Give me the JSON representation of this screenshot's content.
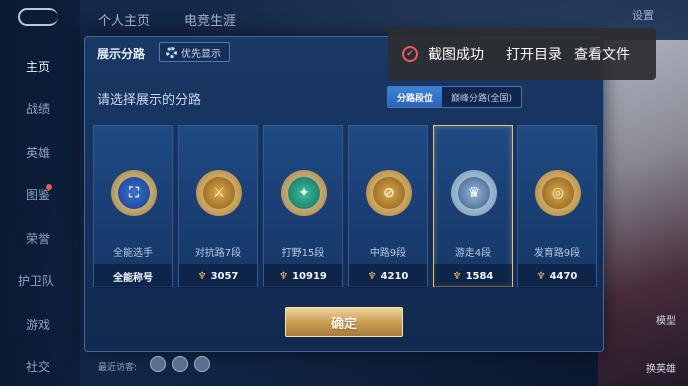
{
  "nav": {
    "items": [
      "主页",
      "战绩",
      "英雄",
      "图鉴",
      "荣誉",
      "护卫队",
      "游戏",
      "社交"
    ]
  },
  "top_tabs": [
    "个人主页",
    "电竞生涯"
  ],
  "top_right": "设置",
  "dialog": {
    "title": "展示分路",
    "priority_label": "优先显示",
    "subtitle": "请选择展示的分路",
    "segments": [
      "分路段位",
      "巅峰分路(全国)"
    ],
    "cards": [
      {
        "name": "全能选手",
        "score": "全能称号",
        "icon": "all-round-emblem-icon",
        "show_score_icon": false
      },
      {
        "name": "对抗路7段",
        "score": "3057",
        "icon": "clash-lane-emblem-icon",
        "show_score_icon": true
      },
      {
        "name": "打野15段",
        "score": "10919",
        "icon": "jungle-emblem-icon",
        "show_score_icon": true
      },
      {
        "name": "中路9段",
        "score": "4210",
        "icon": "mid-lane-emblem-icon",
        "show_score_icon": true
      },
      {
        "name": "游走4段",
        "score": "1584",
        "icon": "roam-emblem-icon",
        "show_score_icon": true
      },
      {
        "name": "发育路9段",
        "score": "4470",
        "icon": "farm-lane-emblem-icon",
        "show_score_icon": true
      }
    ],
    "selected_index": 4,
    "confirm_label": "确定"
  },
  "toast": {
    "message": "截图成功",
    "action_open": "打开目录",
    "action_view": "查看文件"
  },
  "bottom": {
    "visitors_label": "最近访客:"
  },
  "right_labels": [
    "模型",
    "换英雄"
  ],
  "colors": {
    "accent_gold": "#e7c27c",
    "segment_active": "#3c84d8",
    "toast_check": "#f05a5a"
  }
}
